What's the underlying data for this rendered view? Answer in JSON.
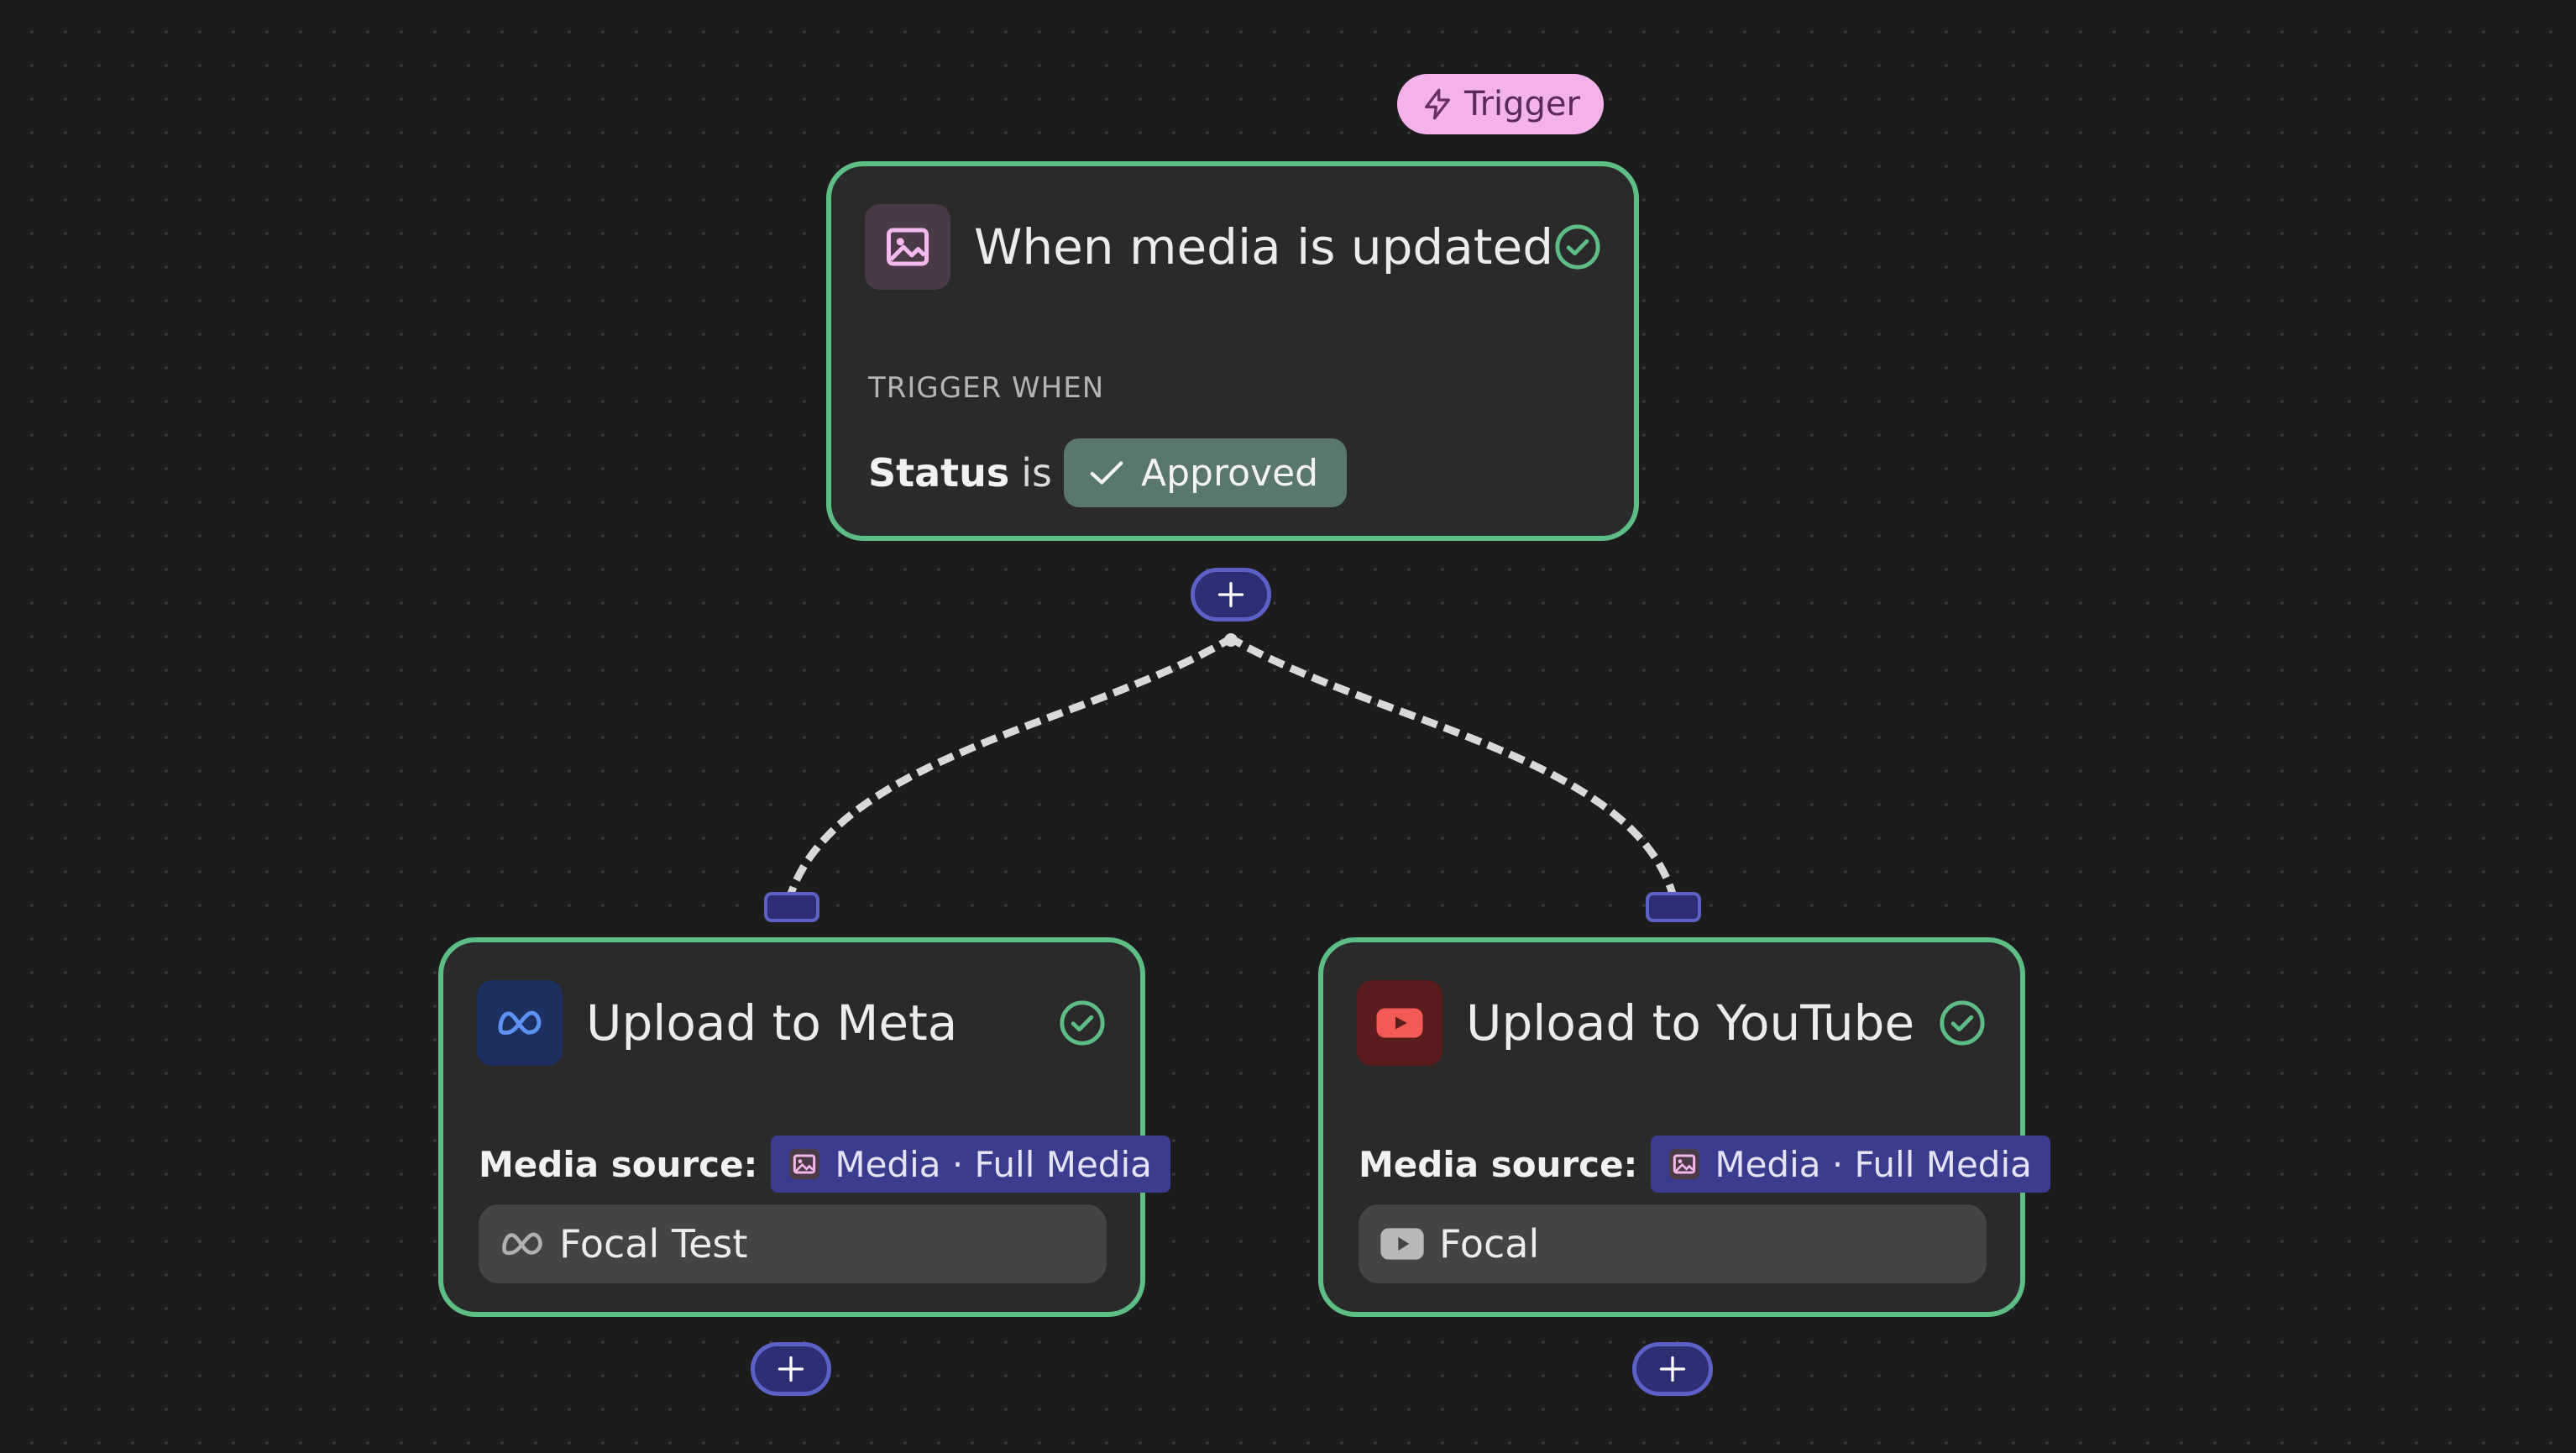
{
  "colors": {
    "canvas_bg": "#1c1c1c",
    "node_border_success": "#5ebd85",
    "node_bg": "#2a2a2a",
    "trigger_pill_bg": "#f4b2ea",
    "approved_chip_bg": "#59786b",
    "media_chip_bg": "#3a3c8e",
    "port_color": "#5b61c7",
    "meta_icon_bg": "#1d3060",
    "youtube_icon_bg": "#5a1c1c",
    "media_icon_bg": "#4a3a48"
  },
  "trigger_badge": {
    "label": "Trigger",
    "icon": "lightning-icon"
  },
  "trigger_node": {
    "icon": "image-icon",
    "title": "When media is updated",
    "status_icon": "check-circle-icon",
    "section_label": "TRIGGER WHEN",
    "condition": {
      "field": "Status",
      "operator": "is",
      "value": "Approved",
      "value_icon": "checkmark-icon"
    }
  },
  "actions": [
    {
      "icon": "meta-logo-icon",
      "title": "Upload to Meta",
      "status_icon": "check-circle-icon",
      "media_source_label": "Media source:",
      "media_source_chip": "Media · Full Media",
      "account": "Focal Test",
      "account_icon": "meta-logo-icon"
    },
    {
      "icon": "youtube-logo-icon",
      "title": "Upload to YouTube",
      "status_icon": "check-circle-icon",
      "media_source_label": "Media source:",
      "media_source_chip": "Media · Full Media",
      "account": "Focal",
      "account_icon": "youtube-logo-icon"
    }
  ],
  "add_step_buttons": {
    "icon": "plus-icon",
    "count": 3
  }
}
